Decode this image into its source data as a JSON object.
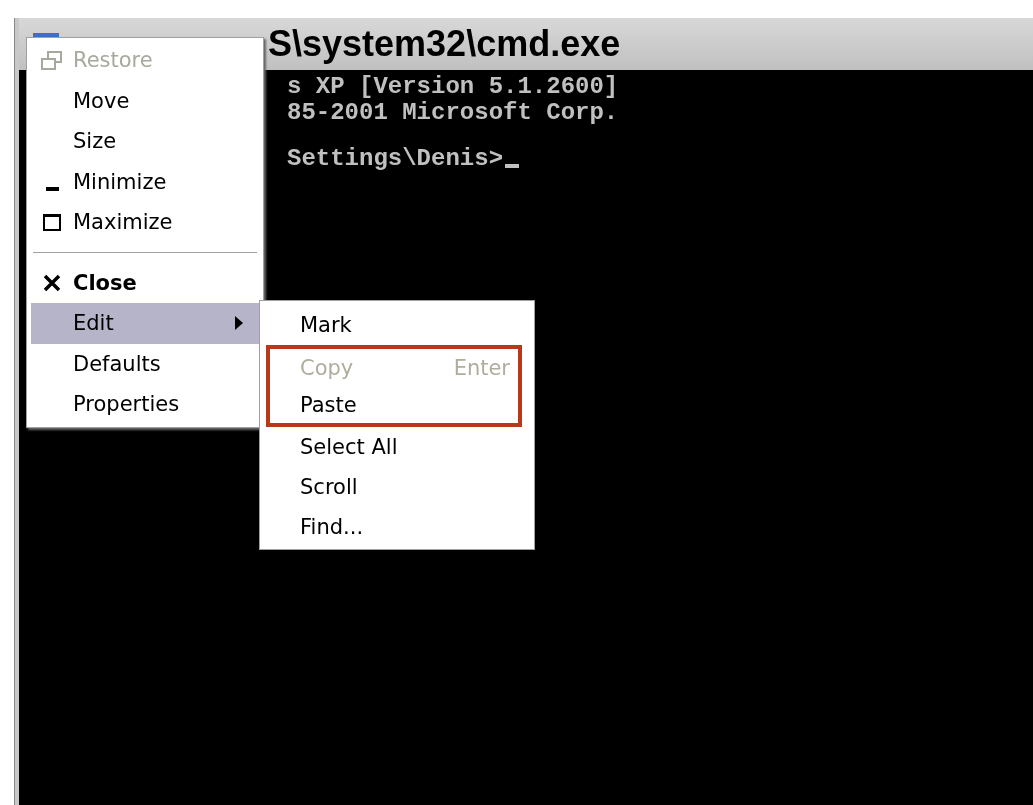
{
  "window": {
    "title": "S\\system32\\cmd.exe"
  },
  "console": {
    "lines": [
      {
        "text": "s XP [Version 5.1.2600]"
      },
      {
        "text": "85-2001 Microsoft Corp."
      },
      {
        "text": "Settings\\Denis>"
      }
    ],
    "cursor": true
  },
  "system_menu": {
    "items": [
      {
        "label": "Restore",
        "kind": "restore",
        "disabled": true,
        "selected": false
      },
      {
        "label": "Move",
        "kind": "plain",
        "disabled": false,
        "selected": false
      },
      {
        "label": "Size",
        "kind": "plain",
        "disabled": false,
        "selected": false
      },
      {
        "label": "Minimize",
        "kind": "minimize",
        "disabled": false,
        "selected": false
      },
      {
        "label": "Maximize",
        "kind": "maximize",
        "disabled": false,
        "selected": false
      },
      {
        "label": "Close",
        "kind": "close",
        "disabled": false,
        "selected": false
      },
      {
        "label": "Edit",
        "kind": "submenu",
        "disabled": false,
        "selected": true
      },
      {
        "label": "Defaults",
        "kind": "plain",
        "disabled": false,
        "selected": false
      },
      {
        "label": "Properties",
        "kind": "plain",
        "disabled": false,
        "selected": false
      }
    ]
  },
  "edit_submenu": {
    "items": [
      {
        "label": "Mark",
        "disabled": false,
        "highlighted": false
      },
      {
        "label": "Copy",
        "shortcut": "Enter",
        "disabled": true,
        "highlighted": true
      },
      {
        "label": "Paste",
        "disabled": false,
        "highlighted": true
      },
      {
        "label": "Select All",
        "disabled": false,
        "highlighted": false
      },
      {
        "label": "Scroll",
        "disabled": false,
        "highlighted": false
      },
      {
        "label": "Find...",
        "disabled": false,
        "highlighted": false
      }
    ]
  }
}
